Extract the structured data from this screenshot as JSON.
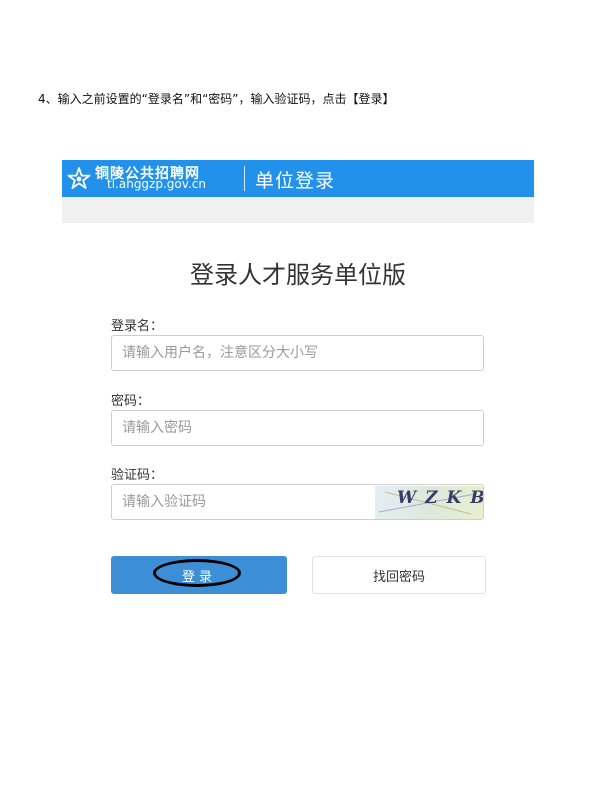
{
  "instruction": "4、输入之前设置的“登录名”和“密码”，输入验证码，点击【登录】",
  "header": {
    "logo_icon": "star-emblem-icon",
    "logo_cn": "铜陵公共招聘网",
    "logo_en": "tl.ahggzp.gov.cn",
    "title": "单位登录",
    "bg_color": "#2191ec"
  },
  "panel": {
    "title": "登录人才服务单位版",
    "username": {
      "label": "登录名：",
      "placeholder": "请输入用户名，注意区分大小写",
      "value": ""
    },
    "password": {
      "label": "密码：",
      "placeholder": "请输入密码",
      "value": ""
    },
    "captcha": {
      "label": "验证码：",
      "placeholder": "请输入验证码",
      "value": "",
      "image_text": "WZKB"
    },
    "login_label": "登录",
    "forgot_label": "找回密码",
    "login_color": "#3c8fd6"
  },
  "annotation": {
    "shape": "ellipse",
    "color": "#000000",
    "target": "login-button"
  }
}
